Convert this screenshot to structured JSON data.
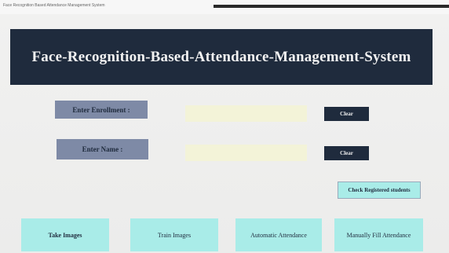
{
  "window": {
    "title": "Face Recognition Based Attendance Management System"
  },
  "header": {
    "heading": "Face-Recognition-Based-Attendance-Management-System"
  },
  "form": {
    "enrollment_label": "Enter Enrollment :",
    "enrollment_value": "",
    "name_label": "Enter Name :",
    "name_value": "",
    "clear_label": "Clear"
  },
  "actions": {
    "check_registered": "Check Registered students",
    "take_images": "Take Images",
    "train_images": "Train Images",
    "automatic_attendance": "Automatic Attendance",
    "manually_fill": "Manually Fill Attendance"
  },
  "colors": {
    "banner": "#1f2b3d",
    "label_bg": "#7e8aa6",
    "input_bg": "#f3f3d8",
    "action_bg": "#a9ece8"
  }
}
